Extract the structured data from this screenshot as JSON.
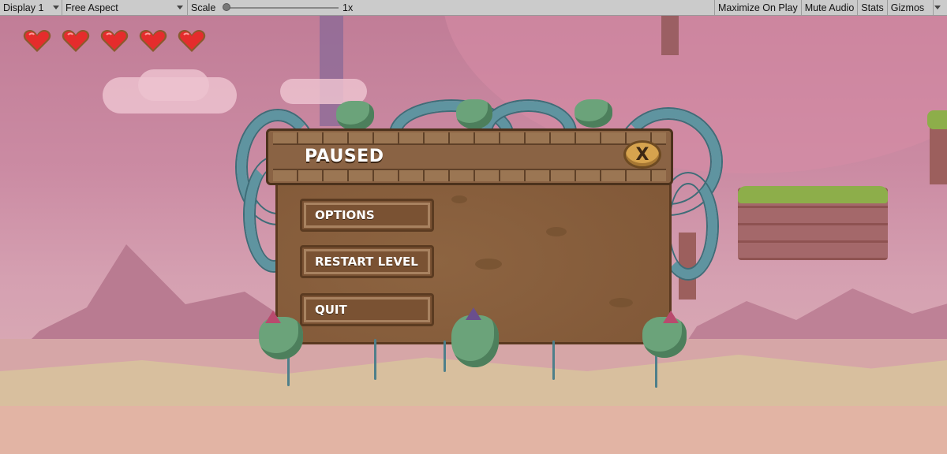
{
  "toolbar": {
    "display": "Display 1",
    "aspect": "Free Aspect",
    "scale_label": "Scale",
    "scale_value": "1x",
    "maximize": "Maximize On Play",
    "mute": "Mute Audio",
    "stats": "Stats",
    "gizmos": "Gizmos"
  },
  "hud": {
    "hearts": 5
  },
  "pause_menu": {
    "title": "PAUSED",
    "close_label": "X",
    "buttons": [
      "OPTIONS",
      "RESTART LEVEL",
      "QUIT"
    ]
  },
  "colors": {
    "sky": "#c17d97",
    "wood": "#875e3c",
    "heart": "#e52c2c",
    "tentacle": "#5f94a0"
  },
  "icons": [
    "heart-icon",
    "close-icon",
    "dropdown-arrow-icon"
  ]
}
